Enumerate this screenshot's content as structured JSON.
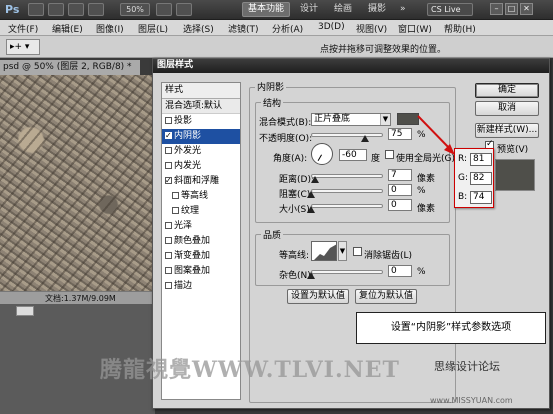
{
  "app": {
    "logo": "Ps",
    "zoom": "50%",
    "workspaces": [
      "基本功能",
      "设计",
      "绘画",
      "摄影"
    ],
    "more": "»",
    "cslive": "CS Live",
    "window_controls": [
      "–",
      "□",
      "✕"
    ]
  },
  "menu": [
    "文件(F)",
    "编辑(E)",
    "图像(I)",
    "图层(L)",
    "选择(S)",
    "滤镜(T)",
    "分析(A)",
    "3D(D)",
    "视图(V)",
    "窗口(W)",
    "帮助(H)"
  ],
  "options_bar": {
    "tool_preset": "▸+ ▾",
    "hint": "点按并拖移可调整效果的位置。"
  },
  "document": {
    "tab": "psd @ 50% (图层 2, RGB/8) *",
    "status": "文档:1.37M/9.09M"
  },
  "dialog": {
    "title": "图层样式",
    "style_header": "样式",
    "blend_options": "混合选项:默认",
    "styles": [
      {
        "label": "投影",
        "checked": false,
        "selected": false,
        "sub": false
      },
      {
        "label": "内阴影",
        "checked": true,
        "selected": true,
        "sub": false
      },
      {
        "label": "外发光",
        "checked": false,
        "selected": false,
        "sub": false
      },
      {
        "label": "内发光",
        "checked": false,
        "selected": false,
        "sub": false
      },
      {
        "label": "斜面和浮雕",
        "checked": true,
        "selected": false,
        "sub": false
      },
      {
        "label": "等高线",
        "checked": false,
        "selected": false,
        "sub": true
      },
      {
        "label": "纹理",
        "checked": false,
        "selected": false,
        "sub": true
      },
      {
        "label": "光泽",
        "checked": false,
        "selected": false,
        "sub": false
      },
      {
        "label": "颜色叠加",
        "checked": false,
        "selected": false,
        "sub": false
      },
      {
        "label": "渐变叠加",
        "checked": false,
        "selected": false,
        "sub": false
      },
      {
        "label": "图案叠加",
        "checked": false,
        "selected": false,
        "sub": false
      },
      {
        "label": "描边",
        "checked": false,
        "selected": false,
        "sub": false
      }
    ],
    "section_title": "内阴影",
    "structure": {
      "group_label": "结构",
      "blend_mode_label": "混合模式(B):",
      "blend_mode_value": "正片叠底",
      "shadow_color": "#4f4f4a",
      "opacity_label": "不透明度(O):",
      "opacity_value": "75",
      "opacity_fraction": 0.75,
      "percent": "%",
      "angle_label": "角度(A):",
      "angle_value": "-60",
      "angle_unit": "度",
      "global_light_label": "使用全局光(G)",
      "global_light_checked": false,
      "distance_label": "距离(D):",
      "distance_value": "7",
      "distance_fraction": 0.05,
      "pixels": "像素",
      "choke_label": "阻塞(C):",
      "choke_value": "0",
      "size_label": "大小(S):",
      "size_value": "0"
    },
    "quality": {
      "group_label": "品质",
      "contour_label": "等高线:",
      "antialias_label": "消除锯齿(L)",
      "antialias_checked": false,
      "noise_label": "杂色(N):",
      "noise_value": "0"
    },
    "buttons": {
      "set_default": "设置为默认值",
      "reset_default": "复位为默认值",
      "ok": "确定",
      "cancel": "取消",
      "new_style": "新建样式(W)...",
      "preview_label": "预览(V)",
      "preview_checked": true
    }
  },
  "color_popup": {
    "rows": [
      {
        "label": "R:",
        "value": "81"
      },
      {
        "label": "G:",
        "value": "82"
      },
      {
        "label": "B:",
        "value": "74"
      }
    ]
  },
  "annotation": {
    "callout": "设置“内阴影”样式参数选项",
    "watermark": "腾龍視覺WWW.TLVI.NET",
    "watermark2": "思缘设计论坛",
    "watermark3": "www.MISSYUAN.com"
  }
}
